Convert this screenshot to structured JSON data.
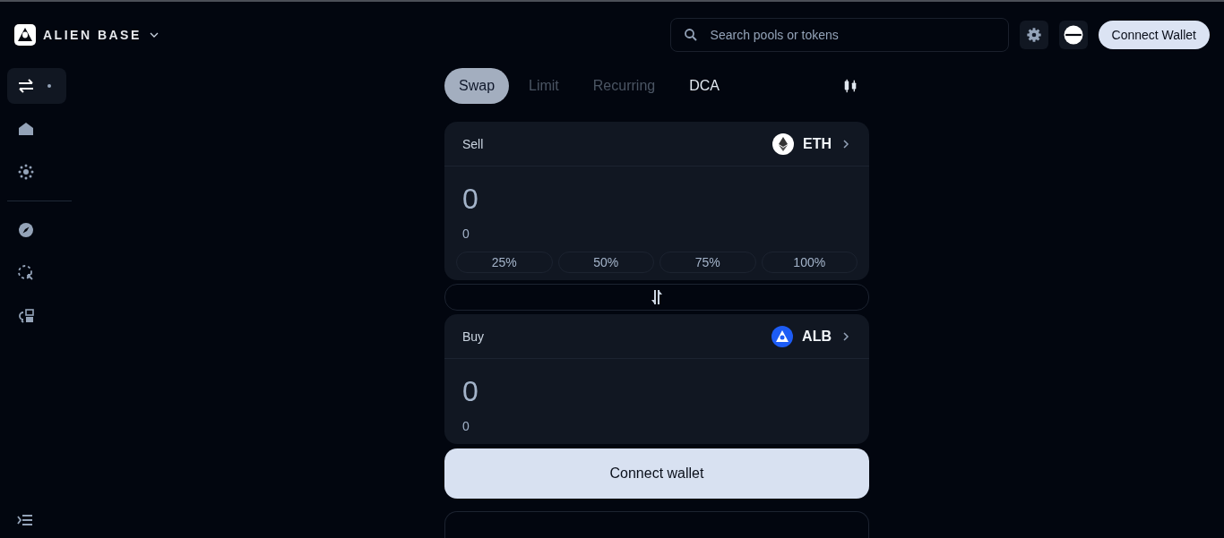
{
  "brand": {
    "name": "ALIEN BASE"
  },
  "search": {
    "placeholder": "Search pools or tokens"
  },
  "header_button": "Connect Wallet",
  "sidebar": {
    "items": [
      {
        "selected": true,
        "dot": true
      },
      {
        "selected": false,
        "dot": false
      },
      {
        "selected": false,
        "dot": false
      },
      {
        "selected": false,
        "dot": false
      },
      {
        "selected": false,
        "dot": false
      },
      {
        "selected": false,
        "dot": false
      }
    ]
  },
  "tabs": [
    {
      "label": "Swap",
      "selected": true,
      "disabled": false
    },
    {
      "label": "Limit",
      "selected": false,
      "disabled": true
    },
    {
      "label": "Recurring",
      "selected": false,
      "disabled": true
    },
    {
      "label": "DCA",
      "selected": false,
      "disabled": false
    }
  ],
  "sell": {
    "label": "Sell",
    "token": "ETH",
    "amount": "0",
    "value": "0",
    "percents": [
      "25%",
      "50%",
      "75%",
      "100%"
    ]
  },
  "buy": {
    "label": "Buy",
    "token": "ALB",
    "amount": "0",
    "value": "0"
  },
  "action_button": "Connect wallet"
}
